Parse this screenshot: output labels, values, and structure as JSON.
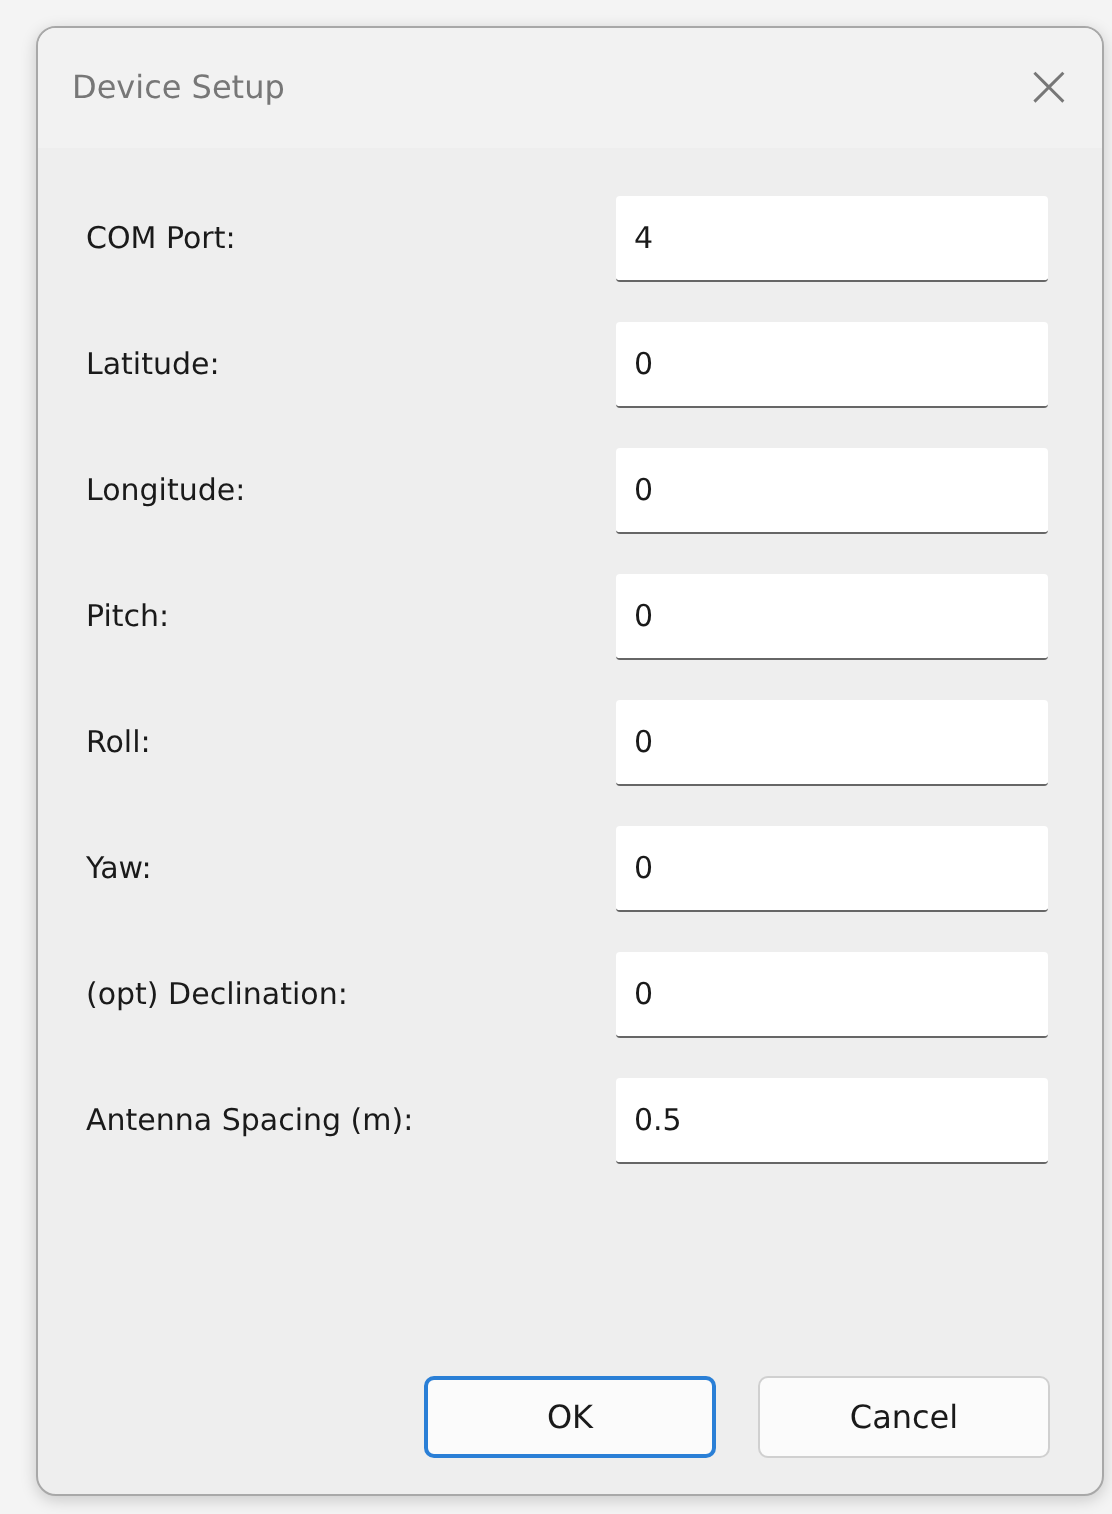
{
  "window": {
    "title": "Device Setup",
    "close": "×"
  },
  "fields": [
    {
      "label": "COM Port:",
      "value": "4"
    },
    {
      "label": "Latitude:",
      "value": "0"
    },
    {
      "label": "Longitude:",
      "value": "0"
    },
    {
      "label": "Pitch:",
      "value": "0"
    },
    {
      "label": "Roll:",
      "value": "0"
    },
    {
      "label": "Yaw:",
      "value": "0"
    },
    {
      "label": "(opt) Declination:",
      "value": "0"
    },
    {
      "label": "Antenna Spacing (m):",
      "value": "0.5"
    }
  ],
  "buttons": [
    {
      "label": "OK",
      "default": true
    },
    {
      "label": "Cancel",
      "default": false
    }
  ]
}
